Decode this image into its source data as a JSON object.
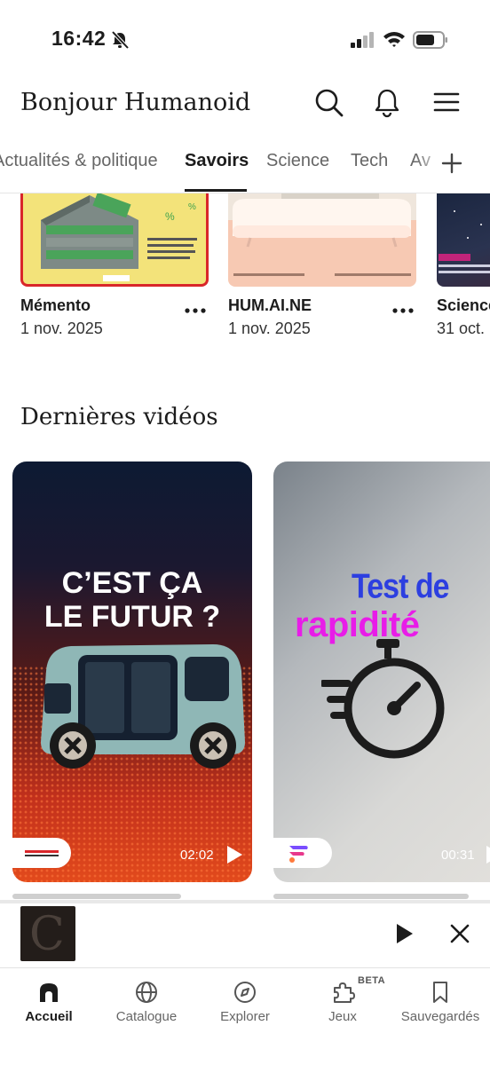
{
  "status_bar": {
    "time": "16:42"
  },
  "header": {
    "greeting": "Bonjour Humanoid"
  },
  "tabs": [
    {
      "label": "Actualités & politique"
    },
    {
      "label": "Savoirs",
      "active": true
    },
    {
      "label": "Science"
    },
    {
      "label": "Tech"
    },
    {
      "label": "Av"
    }
  ],
  "magazines": [
    {
      "title": "Mémento",
      "date": "1 nov. 2025"
    },
    {
      "title": "HUM.AI.NE",
      "date": "1 nov. 2025"
    },
    {
      "title": "Science",
      "date": "31 oct."
    }
  ],
  "videos_section": {
    "title": "Dernières vidéos",
    "items": [
      {
        "headline_1": "C’EST ÇA",
        "headline_2": "LE FUTUR ?",
        "duration": "02:02"
      },
      {
        "headline_1": "Test de",
        "headline_2": "rapidité",
        "duration": "00:31"
      }
    ]
  },
  "mini_player": {
    "art_letter": "C"
  },
  "bottom_nav": [
    {
      "label": "Accueil",
      "icon": "home-icon",
      "active": true
    },
    {
      "label": "Catalogue",
      "icon": "globe-icon"
    },
    {
      "label": "Explorer",
      "icon": "compass-icon"
    },
    {
      "label": "Jeux",
      "icon": "puzzle-icon",
      "badge": "BETA"
    },
    {
      "label": "Sauvegardés",
      "icon": "bookmark-icon"
    }
  ],
  "colors": {
    "accent_text": "#1c1c1c",
    "muted_text": "#666666",
    "memento_red": "#d9262a",
    "test_blue": "#2d3fe0",
    "rapid_magenta": "#e81ce8"
  }
}
